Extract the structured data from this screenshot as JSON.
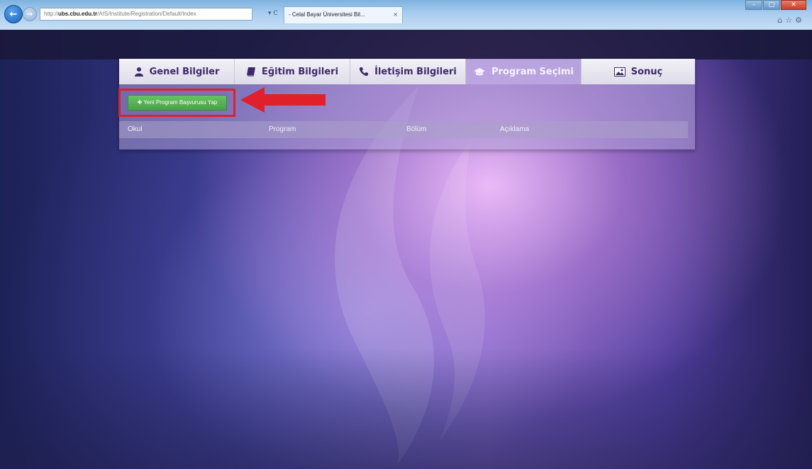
{
  "browser": {
    "url_prefix": "http://",
    "url_host": "ubs.cbu.edu.tr",
    "url_path": "/AIS/Institute/Registration/Default/Index",
    "addr_buttons": "▾ C",
    "tab_title": "- Celal Bayar Üniversitesi Bil...",
    "tab_close": "×",
    "window_controls": {
      "minimize": "–",
      "maximize": "□",
      "close": "✕"
    },
    "icons": [
      "home-icon",
      "star-icon",
      "gear-icon"
    ]
  },
  "tabs": [
    {
      "label": "Genel Bilgiler",
      "icon": "user-icon",
      "active": false
    },
    {
      "label": "Eğitim Bilgileri",
      "icon": "book-icon",
      "active": false
    },
    {
      "label": "İletişim Bilgileri",
      "icon": "phone-icon",
      "active": false
    },
    {
      "label": "Program Seçimi",
      "icon": "graduation-cap-icon",
      "active": true
    },
    {
      "label": "Sonuç",
      "icon": "picture-icon",
      "active": false
    }
  ],
  "main": {
    "add_button_label": "Yeni Program Başvurusu Yap"
  },
  "table": {
    "headers": [
      "Okul",
      "Program",
      "Bölüm",
      "Açıklama"
    ]
  },
  "colors": {
    "tab_text": "#3b2a6a",
    "add_button": "#4fae4c",
    "annotation_red": "#e0202a"
  }
}
